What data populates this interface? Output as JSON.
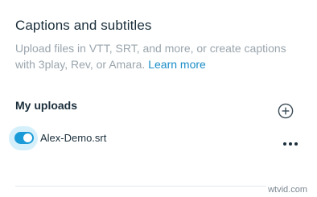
{
  "captions": {
    "title": "Captions and subtitles",
    "description_line1": "Upload files in VTT, SRT, and more, or create captions",
    "description_line2_prefix": "with 3play, Rev, or Amara.",
    "learn_more": "Learn more"
  },
  "uploads": {
    "title": "My uploads",
    "add_icon": "plus-circle-icon",
    "items": [
      {
        "file_name": "Alex-Demo.srt",
        "enabled": true,
        "more_icon": "more-horizontal-icon"
      }
    ]
  },
  "watermark": "wtvid.com",
  "colors": {
    "accent": "#1a9bd7",
    "link": "#1a8cc7",
    "text": "#1a2e3b",
    "muted": "#9aa5ad"
  }
}
